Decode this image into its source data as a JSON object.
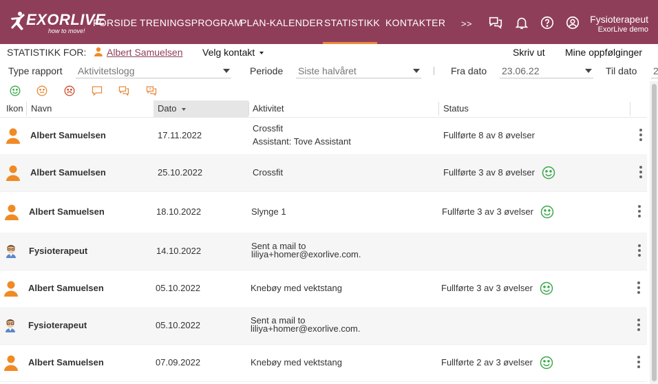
{
  "app": {
    "logo_word": "EXORLIVE",
    "logo_tagline": "how to move!",
    "brand_color": "#8f3e5a",
    "accent_color": "#e98a3c"
  },
  "nav": {
    "items": [
      "FORSIDE",
      "TRENINGSPROGRAM",
      "PLAN-KALENDER",
      "STATISTIKK",
      "KONTAKTER"
    ],
    "more": ">>",
    "active": "STATISTIKK"
  },
  "user": {
    "name": "Fysioterapeut",
    "org": "ExorLive demo"
  },
  "stats_for": {
    "label": "STATISTIKK FOR:",
    "contact": "Albert Samuelsen",
    "choose_contact": "Velg kontakt",
    "print": "Skriv ut",
    "my_followups": "Mine oppfølginger"
  },
  "filters": {
    "report_type_label": "Type rapport",
    "report_type_value": "Aktivitetslogg",
    "period_label": "Periode",
    "period_value": "Siste halvåret",
    "from_label": "Fra dato",
    "from_value": "23.06.22",
    "to_label": "Til dato",
    "to_value": "2"
  },
  "feedback_icons": [
    "smile-icon",
    "neutral-icon",
    "sad-icon",
    "comment-icon",
    "chat-icon",
    "chat-alert-icon"
  ],
  "table": {
    "headers": {
      "icon": "Ikon",
      "name": "Navn",
      "date": "Dato",
      "activity": "Aktivitet",
      "status": "Status"
    },
    "rows": [
      {
        "avatar": "user",
        "name": "Albert Samuelsen",
        "date": "17.11.2022",
        "activity": [
          "Crossfit",
          "Assistant: Tove Assistant"
        ],
        "status": "Fullførte 8 av 8 øvelser",
        "smile": false
      },
      {
        "avatar": "user",
        "name": "Albert Samuelsen",
        "date": "25.10.2022",
        "activity": [
          "Crossfit"
        ],
        "status": "Fullførte 3 av 8 øvelser",
        "smile": true
      },
      {
        "avatar": "user",
        "name": "Albert Samuelsen",
        "date": "18.10.2022",
        "activity": [
          "Slynge 1"
        ],
        "status": "Fullførte 3 av 3 øvelser",
        "smile": true
      },
      {
        "avatar": "therapist",
        "name": "Fysioterapeut",
        "date": "14.10.2022",
        "activity": [
          "Sent a mail to",
          "liliya+homer@exorlive.com."
        ],
        "status": "",
        "smile": false
      },
      {
        "avatar": "user",
        "name": "Albert Samuelsen",
        "date": "05.10.2022",
        "activity": [
          "Knebøy med vektstang"
        ],
        "status": "Fullførte 3 av 3 øvelser",
        "smile": true
      },
      {
        "avatar": "therapist",
        "name": "Fysioterapeut",
        "date": "05.10.2022",
        "activity": [
          "Sent a mail to",
          "liliya+homer@exorlive.com."
        ],
        "status": "",
        "smile": false
      },
      {
        "avatar": "user",
        "name": "Albert Samuelsen",
        "date": "07.09.2022",
        "activity": [
          "Knebøy med vektstang"
        ],
        "status": "Fullførte 2 av 3 øvelser",
        "smile": true
      }
    ]
  }
}
